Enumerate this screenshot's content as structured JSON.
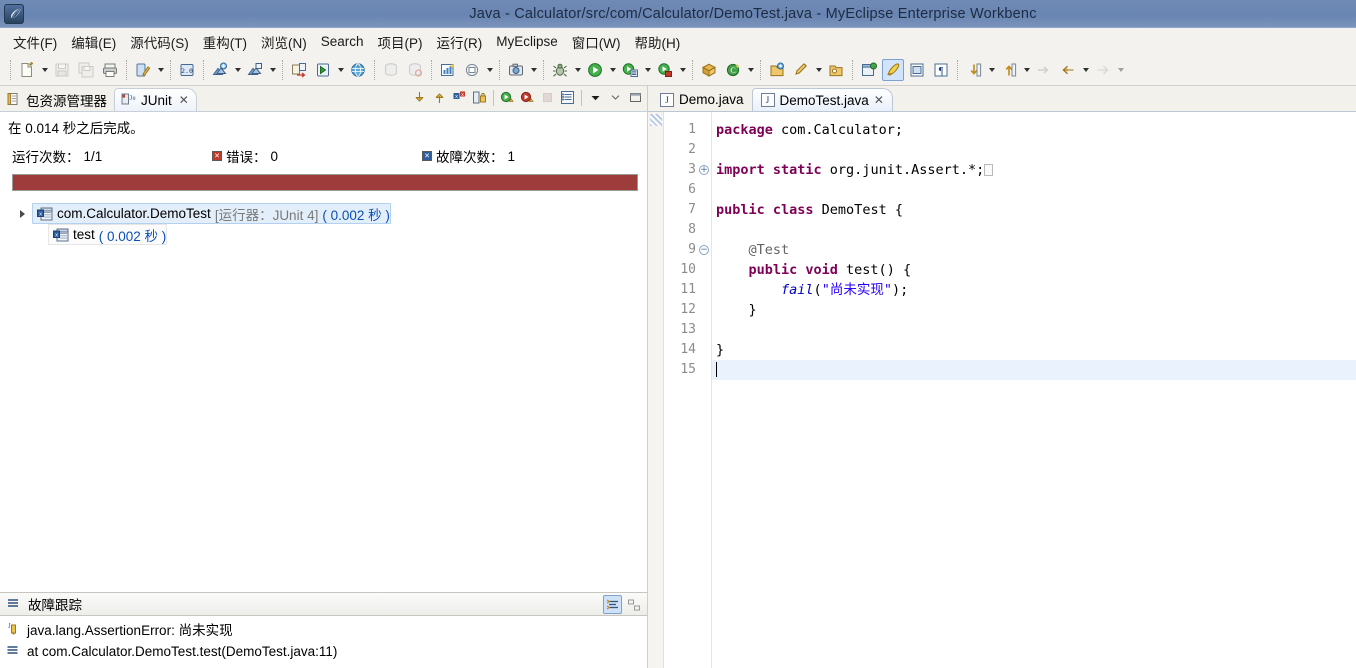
{
  "window": {
    "title": "Java  -  Calculator/src/com/Calculator/DemoTest.java  -  MyEclipse Enterprise Workbenc",
    "app_icon": "myeclipse-logo-icon",
    "titlebar_color": "#6b86b2"
  },
  "menubar": {
    "items": [
      {
        "label": "文件(F)",
        "name": "menu-file"
      },
      {
        "label": "编辑(E)",
        "name": "menu-edit"
      },
      {
        "label": "源代码(S)",
        "name": "menu-source"
      },
      {
        "label": "重构(T)",
        "name": "menu-refactor"
      },
      {
        "label": "浏览(N)",
        "name": "menu-navigate"
      },
      {
        "label": "Search",
        "name": "menu-search"
      },
      {
        "label": "项目(P)",
        "name": "menu-project"
      },
      {
        "label": "运行(R)",
        "name": "menu-run"
      },
      {
        "label": "MyEclipse",
        "name": "menu-myeclipse"
      },
      {
        "label": "窗口(W)",
        "name": "menu-window"
      },
      {
        "label": "帮助(H)",
        "name": "menu-help"
      }
    ]
  },
  "toolbar": {
    "groups": [
      {
        "buttons": [
          {
            "name": "new-icon",
            "glyph": "new",
            "arrow": true,
            "enabled": true
          },
          {
            "name": "save-icon",
            "glyph": "save",
            "arrow": false,
            "enabled": false
          },
          {
            "name": "save-all-icon",
            "glyph": "saveall",
            "arrow": false,
            "enabled": false
          },
          {
            "name": "print-icon",
            "glyph": "print",
            "arrow": false,
            "enabled": true
          }
        ]
      },
      {
        "buttons": [
          {
            "name": "quickfix-icon",
            "glyph": "quickfix",
            "arrow": true,
            "enabled": true
          }
        ]
      },
      {
        "buttons": [
          {
            "name": "jdk-version-icon",
            "glyph": "jdk",
            "arrow": false,
            "enabled": true
          }
        ]
      },
      {
        "buttons": [
          {
            "name": "new-deployment-icon",
            "glyph": "deploy-add",
            "arrow": true,
            "enabled": true
          },
          {
            "name": "manage-deployment-icon",
            "glyph": "deploy-mgr",
            "arrow": true,
            "enabled": true
          }
        ]
      },
      {
        "buttons": [
          {
            "name": "import-export-icon",
            "glyph": "impexp",
            "arrow": false,
            "enabled": true
          },
          {
            "name": "run-server-icon",
            "glyph": "runserver",
            "arrow": true,
            "enabled": true
          },
          {
            "name": "open-browser-icon",
            "glyph": "globe",
            "arrow": false,
            "enabled": true
          }
        ]
      },
      {
        "buttons": [
          {
            "name": "open-db-icon",
            "glyph": "db1",
            "arrow": false,
            "enabled": false
          },
          {
            "name": "db-explorer-icon",
            "glyph": "db2",
            "arrow": false,
            "enabled": false
          }
        ]
      },
      {
        "buttons": [
          {
            "name": "report-icon",
            "glyph": "report",
            "arrow": false,
            "enabled": true
          },
          {
            "name": "uml-icon",
            "glyph": "uml",
            "arrow": true,
            "enabled": true
          }
        ]
      },
      {
        "buttons": [
          {
            "name": "snapshot-icon",
            "glyph": "camera",
            "arrow": true,
            "enabled": true
          }
        ]
      },
      {
        "buttons": [
          {
            "name": "debug-icon",
            "glyph": "bug",
            "arrow": true,
            "enabled": true
          },
          {
            "name": "run-icon",
            "glyph": "run",
            "arrow": true,
            "enabled": true
          },
          {
            "name": "run-history-icon",
            "glyph": "runhist",
            "arrow": true,
            "enabled": true
          },
          {
            "name": "profile-icon",
            "glyph": "profile",
            "arrow": true,
            "enabled": true
          }
        ]
      },
      {
        "buttons": [
          {
            "name": "new-package-icon",
            "glyph": "pkg",
            "arrow": false,
            "enabled": true
          },
          {
            "name": "new-class-icon",
            "glyph": "class",
            "arrow": true,
            "enabled": true
          }
        ]
      },
      {
        "buttons": [
          {
            "name": "open-type-icon",
            "glyph": "opentype",
            "arrow": false,
            "enabled": true
          },
          {
            "name": "search-icon",
            "glyph": "searchpen",
            "arrow": true,
            "enabled": true
          },
          {
            "name": "open-task-icon",
            "glyph": "opentask",
            "arrow": false,
            "enabled": true
          }
        ]
      },
      {
        "buttons": [
          {
            "name": "java-perspective-icon",
            "glyph": "javaper",
            "arrow": false,
            "enabled": true
          },
          {
            "name": "toggle-java-editor-icon",
            "glyph": "javaedit",
            "arrow": false,
            "enabled": true,
            "selected": true
          },
          {
            "name": "toggle-block-selection-icon",
            "glyph": "block",
            "arrow": false,
            "enabled": true
          },
          {
            "name": "show-whitespace-icon",
            "glyph": "pilcrow",
            "arrow": false,
            "enabled": true
          }
        ]
      },
      {
        "buttons": [
          {
            "name": "next-annotation-icon",
            "glyph": "nextann",
            "arrow": true,
            "enabled": true
          },
          {
            "name": "previous-annotation-icon",
            "glyph": "prevann",
            "arrow": true,
            "enabled": true
          },
          {
            "name": "last-edit-location-icon",
            "glyph": "lastedit",
            "arrow": false,
            "enabled": false
          },
          {
            "name": "back-icon",
            "glyph": "back",
            "arrow": true,
            "enabled": true
          },
          {
            "name": "forward-icon",
            "glyph": "forward",
            "arrow": true,
            "enabled": false
          }
        ]
      }
    ]
  },
  "junit_view": {
    "tabs": [
      {
        "label": "包资源管理器",
        "name": "tab-package-explorer",
        "active": false,
        "closable": false
      },
      {
        "label": "JUnit",
        "name": "tab-junit",
        "active": true,
        "closable": true,
        "close_label": "✕"
      }
    ],
    "toolbar_buttons": [
      {
        "name": "next-failure-icon",
        "glyph": "arrow-down"
      },
      {
        "name": "previous-failure-icon",
        "glyph": "arrow-up"
      },
      {
        "name": "show-failures-only-icon",
        "glyph": "failures-only"
      },
      {
        "name": "lock-scroll-icon",
        "glyph": "lock"
      },
      {
        "name": "rerun-test-icon",
        "glyph": "rerun"
      },
      {
        "name": "rerun-failed-tests-icon",
        "glyph": "rerun-failed"
      },
      {
        "name": "stop-icon",
        "glyph": "stop"
      },
      {
        "name": "test-run-history-icon",
        "glyph": "history"
      },
      {
        "name": "view-menu-icon",
        "glyph": "chevron-down"
      },
      {
        "name": "minimize-view-icon",
        "glyph": "minimize"
      },
      {
        "name": "maximize-view-icon",
        "glyph": "maximize"
      }
    ],
    "status_text": "在 0.014 秒之后完成。",
    "counters": {
      "runs_label": "运行次数：",
      "runs_value": "1/1",
      "errors_label": "错误：",
      "errors_value": "0",
      "failures_label": "故障次数：",
      "failures_value": "1"
    },
    "progress": {
      "percent": 100,
      "color": "#9e3c3c",
      "state": "failed"
    },
    "tree": [
      {
        "name": "test-class-node",
        "label": "com.Calculator.DemoTest",
        "runner": "[运行器：JUnit 4]",
        "time": "( 0.002 秒 )",
        "selected": true,
        "expanded": true,
        "icon": "junit-failure-icon"
      },
      {
        "name": "test-method-node",
        "label": "test",
        "runner": "",
        "time": "( 0.002 秒 )",
        "selected": false,
        "expanded": false,
        "icon": "junit-failure-icon"
      }
    ],
    "failure_trace": {
      "header": "故障跟踪",
      "header_icon": "trace-list-icon",
      "tools": [
        {
          "name": "filter-stack-trace-icon",
          "glyph": "filter",
          "selected": true
        },
        {
          "name": "compare-result-icon",
          "glyph": "compare",
          "selected": false
        }
      ],
      "rows": [
        {
          "name": "trace-exception-row",
          "icon": "exception-icon",
          "text": "java.lang.AssertionError: 尚未实现"
        },
        {
          "name": "trace-frame-row",
          "icon": "stack-frame-icon",
          "text": "at com.Calculator.DemoTest.test(DemoTest.java:11)"
        }
      ]
    }
  },
  "editor": {
    "tabs": [
      {
        "label": "Demo.java",
        "name": "tab-demo-java",
        "active": false,
        "closable": false
      },
      {
        "label": "DemoTest.java",
        "name": "tab-demotest-java",
        "active": true,
        "closable": true,
        "close_label": "✕"
      }
    ],
    "gutter_lines": [
      "1",
      "2",
      "3",
      "6",
      "7",
      "8",
      "9",
      "10",
      "11",
      "12",
      "13",
      "14",
      "15"
    ],
    "folds": {
      "3": "+",
      "9": "−"
    },
    "current_line": "15",
    "code_lines": [
      {
        "n": "1",
        "tokens": [
          {
            "t": "kw",
            "v": "package"
          },
          {
            "t": "plain",
            "v": " com.Calculator;"
          }
        ]
      },
      {
        "n": "2",
        "tokens": []
      },
      {
        "n": "3",
        "tokens": [
          {
            "t": "kw",
            "v": "import static"
          },
          {
            "t": "plain",
            "v": " org.junit.Assert.*;"
          },
          {
            "t": "ph",
            "v": ""
          }
        ]
      },
      {
        "n": "6",
        "tokens": []
      },
      {
        "n": "7",
        "tokens": [
          {
            "t": "kw",
            "v": "public class"
          },
          {
            "t": "plain",
            "v": " DemoTest {"
          }
        ]
      },
      {
        "n": "8",
        "tokens": []
      },
      {
        "n": "9",
        "tokens": [
          {
            "t": "plain",
            "v": "    "
          },
          {
            "t": "ann",
            "v": "@Test"
          }
        ]
      },
      {
        "n": "10",
        "tokens": [
          {
            "t": "plain",
            "v": "    "
          },
          {
            "t": "kw",
            "v": "public void"
          },
          {
            "t": "plain",
            "v": " test() {"
          }
        ]
      },
      {
        "n": "11",
        "tokens": [
          {
            "t": "plain",
            "v": "        "
          },
          {
            "t": "mth",
            "v": "fail"
          },
          {
            "t": "plain",
            "v": "("
          },
          {
            "t": "str",
            "v": "\"尚未实现\""
          },
          {
            "t": "plain",
            "v": ");"
          }
        ]
      },
      {
        "n": "12",
        "tokens": [
          {
            "t": "plain",
            "v": "    }"
          }
        ]
      },
      {
        "n": "13",
        "tokens": []
      },
      {
        "n": "14",
        "tokens": [
          {
            "t": "plain",
            "v": "}"
          }
        ]
      },
      {
        "n": "15",
        "tokens": [
          {
            "t": "caret",
            "v": ""
          }
        ]
      }
    ]
  }
}
